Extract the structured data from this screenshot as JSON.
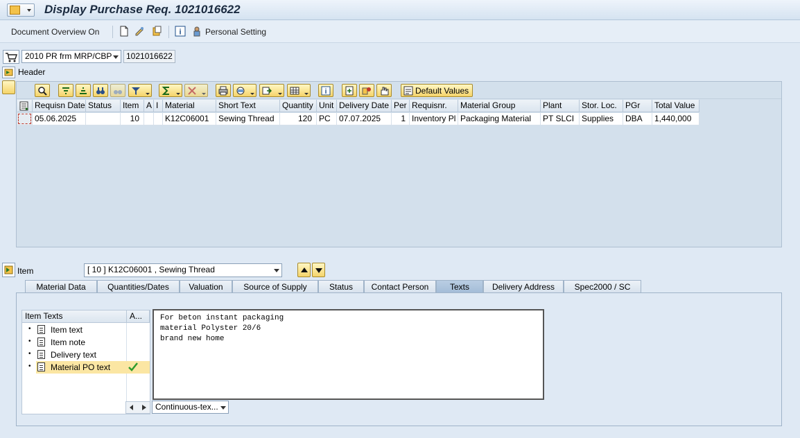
{
  "title": "Display Purchase Req. 1021016622",
  "toolbar": {
    "document_overview": "Document Overview On",
    "personal_setting": "Personal Setting"
  },
  "doc_type": {
    "selected": "2010 PR frm MRP/CBP",
    "number": "1021016622"
  },
  "header_label": "Header",
  "grid": {
    "default_values": "Default Values",
    "columns": [
      "Requisn Date",
      "Status",
      "Item",
      "A",
      "I",
      "Material",
      "Short Text",
      "Quantity",
      "Unit",
      "Delivery Date",
      "Per",
      "Requisnr.",
      "Material Group",
      "Plant",
      "Stor. Loc.",
      "PGr",
      "Total Value"
    ],
    "row": {
      "requisn_date": "05.06.2025",
      "status": "",
      "item": "10",
      "a": "",
      "i": "",
      "material": "K12C06001",
      "short_text": "Sewing Thread",
      "quantity": "120",
      "unit": "PC",
      "delivery_date": "07.07.2025",
      "per": "1",
      "requisnr": "Inventory Pl",
      "material_group": "Packaging Material",
      "plant": "PT SLCI",
      "stor_loc": "Supplies",
      "pgr": "DBA",
      "total_value": "1,440,000"
    }
  },
  "item_section": {
    "label": "Item",
    "selected": "[ 10 ] K12C06001 , Sewing Thread"
  },
  "tabs": [
    "Material Data",
    "Quantities/Dates",
    "Valuation",
    "Source of Supply",
    "Status",
    "Contact Person",
    "Texts",
    "Delivery Address",
    "Spec2000 / SC"
  ],
  "active_tab": "Texts",
  "texts": {
    "col_item_texts": "Item Texts",
    "col_a": "A...",
    "items": [
      "Item text",
      "Item note",
      "Delivery text",
      "Material PO text"
    ],
    "selected_item": "Material PO text",
    "editor_lines": [
      "For beton instant packaging",
      "material Polyster 20/6",
      "brand new home"
    ],
    "format_select": "Continuous-tex..."
  },
  "colors": {
    "accent_selection": "#fbe6a3",
    "check_green": "#2e9b2e"
  }
}
